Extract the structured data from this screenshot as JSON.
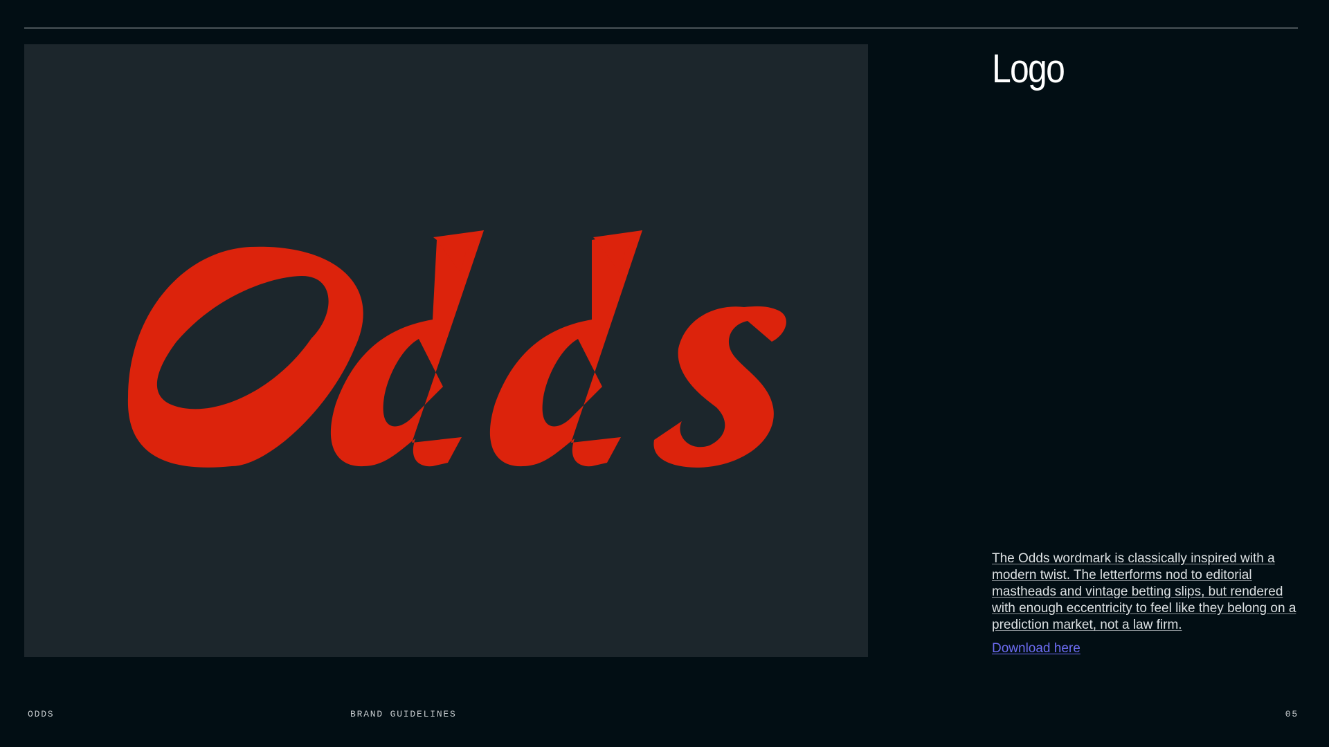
{
  "slide": {
    "title": "Logo",
    "description": "The Odds wordmark is classically inspired with a modern twist. The letterforms nod to editorial mastheads and vintage betting slips, but rendered with enough eccentricity to feel like they belong on a prediction market, not a law firm.",
    "download_label": "Download here"
  },
  "logo": {
    "wordmark": "Odds",
    "color": "#dc230c",
    "background": "#1c262c"
  },
  "footer": {
    "brand": "ODDS",
    "section": "BRAND GUIDELINES",
    "page_number": "05"
  },
  "colors": {
    "page_background": "#020e14",
    "link": "#6d6cf2",
    "text": "#dde1e3"
  }
}
